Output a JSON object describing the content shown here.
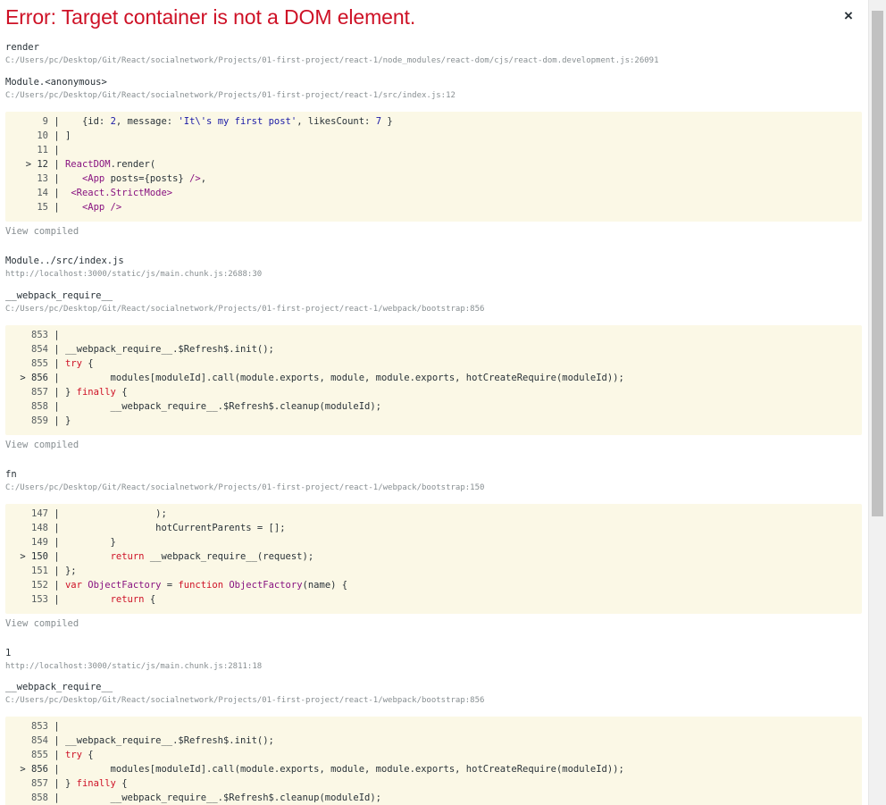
{
  "error": {
    "title": "Error: Target container is not a DOM element.",
    "close_symbol": "×"
  },
  "frames": [
    {
      "fn": "render",
      "loc": "C:/Users/pc/Desktop/Git/React/socialnetwork/Projects/01-first-project/react-1/node_modules/react-dom/cjs/react-dom.development.js:26091"
    },
    {
      "fn": "Module.<anonymous>",
      "loc": "C:/Users/pc/Desktop/Git/React/socialnetwork/Projects/01-first-project/react-1/src/index.js:12"
    },
    {
      "fn": "Module../src/index.js",
      "loc": "http://localhost:3000/static/js/main.chunk.js:2688:30"
    },
    {
      "fn": "__webpack_require__",
      "loc": "C:/Users/pc/Desktop/Git/React/socialnetwork/Projects/01-first-project/react-1/webpack/bootstrap:856"
    },
    {
      "fn": "fn",
      "loc": "C:/Users/pc/Desktop/Git/React/socialnetwork/Projects/01-first-project/react-1/webpack/bootstrap:150"
    },
    {
      "fn": "1",
      "loc": "http://localhost:3000/static/js/main.chunk.js:2811:18"
    },
    {
      "fn": "__webpack_require__",
      "loc": "C:/Users/pc/Desktop/Git/React/socialnetwork/Projects/01-first-project/react-1/webpack/bootstrap:856"
    }
  ],
  "view_compiled_label": "View compiled",
  "code_blocks": [
    {
      "lines": [
        {
          "marker": "",
          "num": "9",
          "segments": [
            [
              "p",
              "    {id: "
            ],
            [
              "n",
              "2"
            ],
            [
              "p",
              ", message: "
            ],
            [
              "s",
              "'It\\'s my first post'"
            ],
            [
              "p",
              ", likesCount: "
            ],
            [
              "n",
              "7"
            ],
            [
              "p",
              " }"
            ]
          ]
        },
        {
          "marker": "",
          "num": "10",
          "segments": [
            [
              "p",
              " ]"
            ]
          ]
        },
        {
          "marker": "",
          "num": "11",
          "segments": []
        },
        {
          "marker": ">",
          "num": "12",
          "segments": [
            [
              "p",
              " "
            ],
            [
              "t",
              "ReactDOM"
            ],
            [
              "p",
              ".render("
            ]
          ]
        },
        {
          "marker": "",
          "num": "13",
          "segments": [
            [
              "p",
              "    "
            ],
            [
              "t",
              "<App"
            ],
            [
              "p",
              " posts={posts} "
            ],
            [
              "t",
              "/>"
            ],
            [
              "p",
              ","
            ]
          ]
        },
        {
          "marker": "",
          "num": "14",
          "segments": [
            [
              "p",
              "  "
            ],
            [
              "t",
              "<React.StrictMode>"
            ]
          ]
        },
        {
          "marker": "",
          "num": "15",
          "segments": [
            [
              "p",
              "    "
            ],
            [
              "t",
              "<App />"
            ]
          ]
        }
      ]
    },
    {
      "lines": [
        {
          "marker": "",
          "num": "853",
          "segments": []
        },
        {
          "marker": "",
          "num": "854",
          "segments": [
            [
              "p",
              " __webpack_require__.$Refresh$.init();"
            ]
          ]
        },
        {
          "marker": "",
          "num": "855",
          "segments": [
            [
              "p",
              " "
            ],
            [
              "k",
              "try"
            ],
            [
              "p",
              " {"
            ]
          ]
        },
        {
          "marker": ">",
          "num": "856",
          "segments": [
            [
              "p",
              "         modules[moduleId].call(module.exports, module, module.exports, hotCreateRequire(moduleId));"
            ]
          ]
        },
        {
          "marker": "",
          "num": "857",
          "segments": [
            [
              "p",
              " } "
            ],
            [
              "k",
              "finally"
            ],
            [
              "p",
              " {"
            ]
          ]
        },
        {
          "marker": "",
          "num": "858",
          "segments": [
            [
              "p",
              "         __webpack_require__.$Refresh$.cleanup(moduleId);"
            ]
          ]
        },
        {
          "marker": "",
          "num": "859",
          "segments": [
            [
              "p",
              " }"
            ]
          ]
        }
      ]
    },
    {
      "lines": [
        {
          "marker": "",
          "num": "147",
          "segments": [
            [
              "p",
              "                 );"
            ]
          ]
        },
        {
          "marker": "",
          "num": "148",
          "segments": [
            [
              "p",
              "                 hotCurrentParents = [];"
            ]
          ]
        },
        {
          "marker": "",
          "num": "149",
          "segments": [
            [
              "p",
              "         }"
            ]
          ]
        },
        {
          "marker": ">",
          "num": "150",
          "segments": [
            [
              "p",
              "         "
            ],
            [
              "k",
              "return"
            ],
            [
              "p",
              " __webpack_require__(request);"
            ]
          ]
        },
        {
          "marker": "",
          "num": "151",
          "segments": [
            [
              "p",
              " };"
            ]
          ]
        },
        {
          "marker": "",
          "num": "152",
          "segments": [
            [
              "p",
              " "
            ],
            [
              "k",
              "var"
            ],
            [
              "p",
              " "
            ],
            [
              "t",
              "ObjectFactory"
            ],
            [
              "p",
              " = "
            ],
            [
              "k",
              "function"
            ],
            [
              "p",
              " "
            ],
            [
              "t",
              "ObjectFactory"
            ],
            [
              "p",
              "(name) {"
            ]
          ]
        },
        {
          "marker": "",
          "num": "153",
          "segments": [
            [
              "p",
              "         "
            ],
            [
              "k",
              "return"
            ],
            [
              "p",
              " {"
            ]
          ]
        }
      ]
    },
    {
      "lines": [
        {
          "marker": "",
          "num": "853",
          "segments": []
        },
        {
          "marker": "",
          "num": "854",
          "segments": [
            [
              "p",
              " __webpack_require__.$Refresh$.init();"
            ]
          ]
        },
        {
          "marker": "",
          "num": "855",
          "segments": [
            [
              "p",
              " "
            ],
            [
              "k",
              "try"
            ],
            [
              "p",
              " {"
            ]
          ]
        },
        {
          "marker": ">",
          "num": "856",
          "segments": [
            [
              "p",
              "         modules[moduleId].call(module.exports, module, module.exports, hotCreateRequire(moduleId));"
            ]
          ]
        },
        {
          "marker": "",
          "num": "857",
          "segments": [
            [
              "p",
              " } "
            ],
            [
              "k",
              "finally"
            ],
            [
              "p",
              " {"
            ]
          ]
        },
        {
          "marker": "",
          "num": "858",
          "segments": [
            [
              "p",
              "         __webpack_require__.$Refresh$.cleanup(moduleId);"
            ]
          ]
        }
      ]
    }
  ]
}
